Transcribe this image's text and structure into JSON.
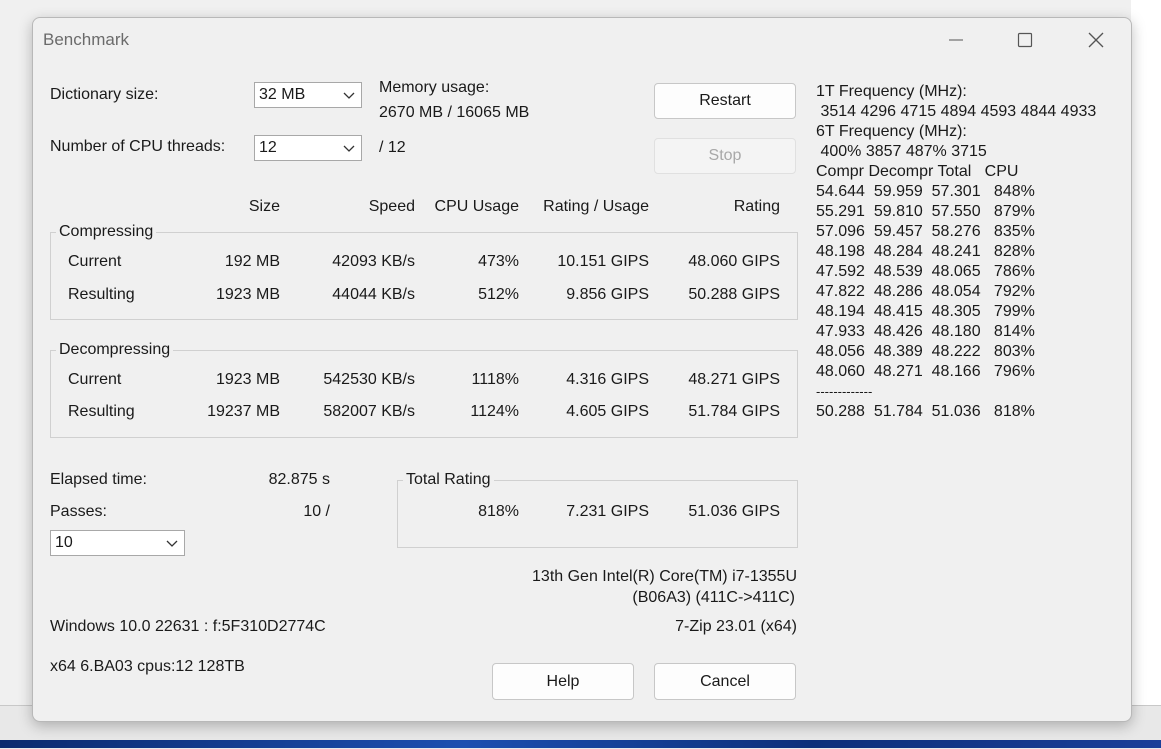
{
  "window": {
    "title": "Benchmark"
  },
  "settings": {
    "dict_label": "Dictionary size:",
    "dict_value": "32 MB",
    "threads_label": "Number of CPU threads:",
    "threads_value": "12",
    "threads_max": "/ 12",
    "memory_label": "Memory usage:",
    "memory_value": "2670 MB / 16065 MB"
  },
  "buttons": {
    "restart": "Restart",
    "stop": "Stop",
    "help": "Help",
    "cancel": "Cancel"
  },
  "columns": {
    "size": "Size",
    "speed": "Speed",
    "cpu_usage": "CPU Usage",
    "rating_usage": "Rating / Usage",
    "rating": "Rating"
  },
  "compressing": {
    "label": "Compressing",
    "rows": [
      {
        "name": "Current",
        "size": "192 MB",
        "speed": "42093 KB/s",
        "cpu": "473%",
        "ru": "10.151 GIPS",
        "rating": "48.060 GIPS"
      },
      {
        "name": "Resulting",
        "size": "1923 MB",
        "speed": "44044 KB/s",
        "cpu": "512%",
        "ru": "9.856 GIPS",
        "rating": "50.288 GIPS"
      }
    ]
  },
  "decompressing": {
    "label": "Decompressing",
    "rows": [
      {
        "name": "Current",
        "size": "1923 MB",
        "speed": "542530 KB/s",
        "cpu": "1118%",
        "ru": "4.316 GIPS",
        "rating": "48.271 GIPS"
      },
      {
        "name": "Resulting",
        "size": "19237 MB",
        "speed": "582007 KB/s",
        "cpu": "1124%",
        "ru": "4.605 GIPS",
        "rating": "51.784 GIPS"
      }
    ]
  },
  "elapsed": {
    "label": "Elapsed time:",
    "value": "82.875 s"
  },
  "passes": {
    "label": "Passes:",
    "value": "10 /",
    "select_value": "10"
  },
  "total": {
    "label": "Total Rating",
    "cpu": "818%",
    "ru": "7.231 GIPS",
    "rating": "51.036 GIPS"
  },
  "cpu_info": {
    "line1": "13th Gen Intel(R) Core(TM) i7-1355U",
    "line2": "(B06A3) (411C->411C)"
  },
  "os_info": "Windows 10.0 22631 :  f:5F310D2774C",
  "version": "7-Zip 23.01 (x64)",
  "sys_info": "x64 6.BA03 cpus:12 128TB",
  "freq": {
    "t1_label": "1T Frequency (MHz):",
    "t1_values": " 3514 4296 4715 4894 4593 4844 4933",
    "t6_label": "6T Frequency (MHz):",
    "t6_values": " 400% 3857 487% 3715"
  },
  "results_table": {
    "header": "Compr Decompr Total   CPU",
    "rows": [
      "54.644  59.959  57.301   848%",
      "55.291  59.810  57.550   879%",
      "57.096  59.457  58.276   835%",
      "48.198  48.284  48.241   828%",
      "47.592  48.539  48.065   786%",
      "47.822  48.286  48.054   792%",
      "48.194  48.415  48.305   799%",
      "47.933  48.426  48.180   814%",
      "48.056  48.389  48.222   803%",
      "48.060  48.271  48.166   796%"
    ],
    "separator": "-------------",
    "total": "50.288  51.784  51.036   818%"
  }
}
